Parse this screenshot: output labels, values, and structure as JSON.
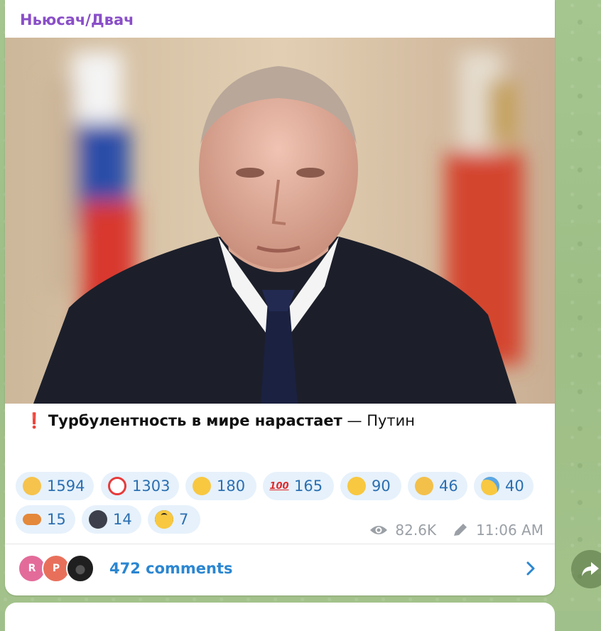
{
  "channel": {
    "name": "Ньюсач/Двач"
  },
  "post": {
    "caption_icon": "❗",
    "caption_bold": "Турбулентность в мире нарастает",
    "caption_rest": " — Путин"
  },
  "reactions": [
    {
      "icon": "thumbs-up-icon",
      "count": "1594"
    },
    {
      "icon": "clown-face-icon",
      "count": "1303"
    },
    {
      "icon": "grinning-face-icon",
      "count": "180"
    },
    {
      "icon": "hundred-points-icon",
      "count": "165"
    },
    {
      "icon": "rofl-face-icon",
      "count": "90"
    },
    {
      "icon": "thinking-face-icon",
      "count": "46"
    },
    {
      "icon": "crying-face-icon",
      "count": "40"
    },
    {
      "icon": "hot-dog-icon",
      "count": "15"
    },
    {
      "icon": "new-moon-face-icon",
      "count": "14"
    },
    {
      "icon": "sunglasses-face-icon",
      "count": "7"
    }
  ],
  "meta": {
    "views": "82.6K",
    "time": "11:06 AM"
  },
  "comments": {
    "label": "472 comments",
    "avatars": [
      {
        "letter": "R",
        "color": "#e36b9a"
      },
      {
        "letter": "P",
        "color": "#e8705b"
      },
      {
        "letter": "",
        "color": "#2a2a2a"
      }
    ]
  },
  "colors": {
    "channel_name": "#8a4fc8",
    "link": "#2b86d1",
    "reaction_bg": "#e6f1fb"
  }
}
